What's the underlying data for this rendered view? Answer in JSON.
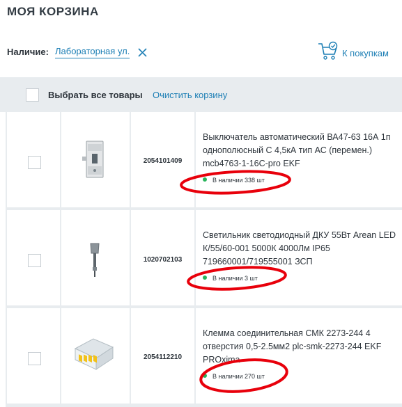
{
  "page": {
    "title": "МОЯ КОРЗИНА"
  },
  "availability": {
    "label": "Наличие:",
    "value": "Лабораторная ул.",
    "clear_icon": "close-icon"
  },
  "shop_link": {
    "label": "К покупкам",
    "icon": "cart-check-icon"
  },
  "bulk": {
    "select_all": "Выбрать все товары",
    "clear_cart": "Очистить корзину"
  },
  "items": [
    {
      "sku": "2054101409",
      "name": "Выключатель автоматический ВА47-63 16А 1п однополюсный С 4,5кА тип АС (перемен.) mcb4763-1-16C-pro EKF",
      "stock": "В наличии 338 шт",
      "image": "circuit-breaker-image"
    },
    {
      "sku": "1020702103",
      "name": "Светильник светодиодный ДКУ 55Вт Arean LED К/55/60-001 5000К 4000Лм IP65 719660001/719555001 ЗСП",
      "stock": "В наличии 3 шт",
      "image": "street-light-image"
    },
    {
      "sku": "2054112210",
      "name": "Клемма соединительная СМК 2273-244 4 отверстия 0,5-2.5мм2 plc-smk-2273-244 EKF PROxima",
      "stock": "В наличии 270 шт",
      "image": "terminal-clamp-image"
    }
  ],
  "colors": {
    "accent": "#1d7fb5",
    "in_stock": "#27b45a",
    "annotation": "#e8000b",
    "bar_bg": "#e8ecef"
  }
}
